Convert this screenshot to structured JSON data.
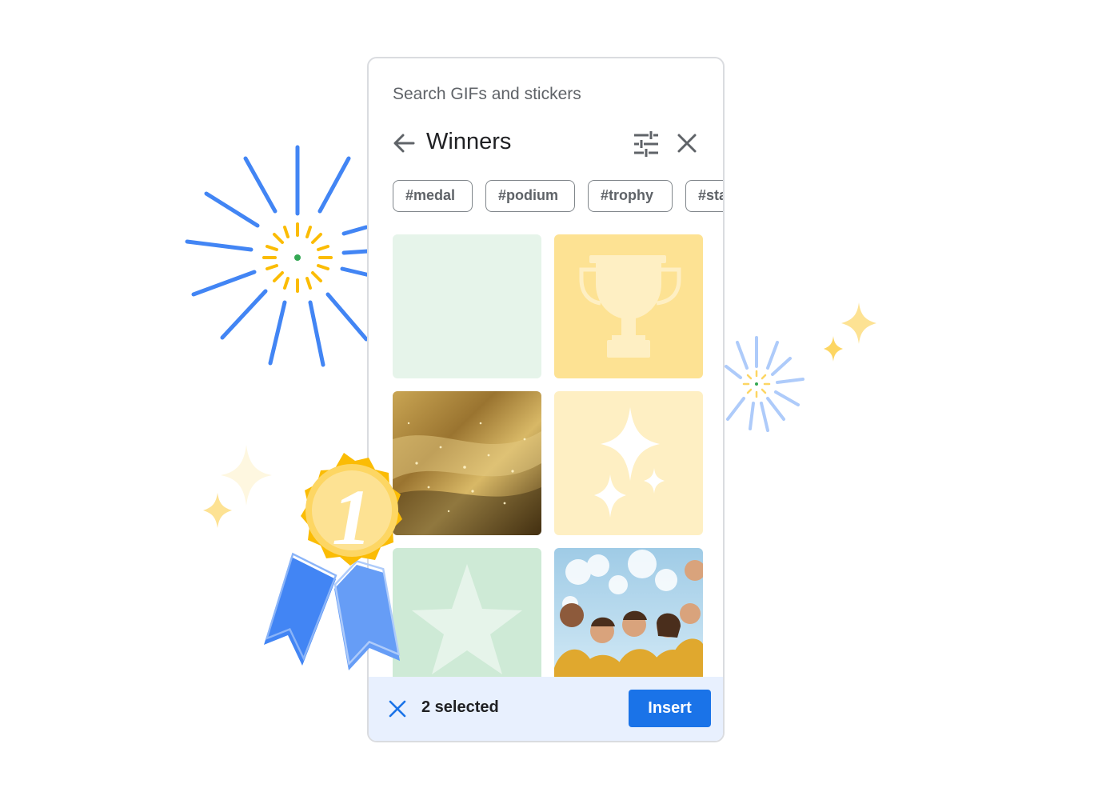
{
  "search": {
    "placeholder": "Search GIFs and stickers"
  },
  "header": {
    "query": "Winners"
  },
  "chips": [
    {
      "label": "#medal"
    },
    {
      "label": "#podium"
    },
    {
      "label": "#trophy"
    },
    {
      "label": "#sta"
    }
  ],
  "results": [
    {
      "kind": "blank",
      "color": "#e6f4ea"
    },
    {
      "kind": "trophy-icon",
      "color": "#fde293"
    },
    {
      "kind": "gold-glitter-photo",
      "color": "#8a6a2a"
    },
    {
      "kind": "sparkle-icon",
      "color": "#feefc3"
    },
    {
      "kind": "star-icon",
      "color": "#ceead6"
    },
    {
      "kind": "celebrating-team-photo",
      "color": "#e0b64a"
    }
  ],
  "footer": {
    "selected_label": "2 selected",
    "insert_label": "Insert"
  },
  "medal": {
    "rank": "1"
  },
  "colors": {
    "primary": "#1a73e8",
    "gold": "#fbbc04",
    "blue_burst": "#4285f4"
  }
}
